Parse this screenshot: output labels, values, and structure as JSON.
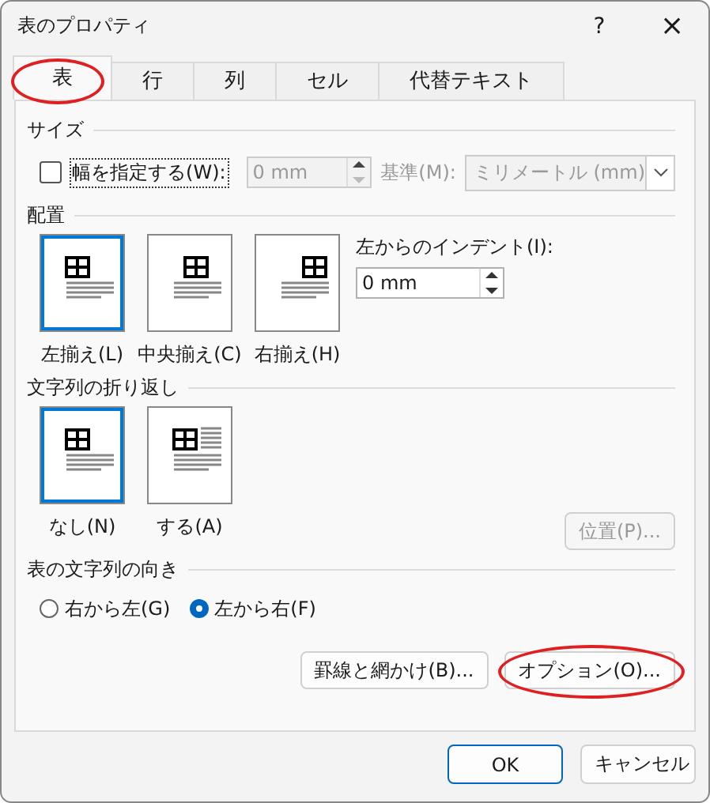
{
  "window": {
    "title": "表のプロパティ",
    "help": "?",
    "close": "×"
  },
  "tabs": [
    {
      "label": "表",
      "selected": true,
      "circled": true
    },
    {
      "label": "行",
      "selected": false,
      "circled": false
    },
    {
      "label": "列",
      "selected": false,
      "circled": false
    },
    {
      "label": "セル",
      "selected": false,
      "circled": false
    },
    {
      "label": "代替テキスト",
      "selected": false,
      "circled": false
    }
  ],
  "size": {
    "heading": "サイズ",
    "width_checkbox": {
      "label": "幅を指定する(W):",
      "checked": false
    },
    "width_field": {
      "value": "0 mm",
      "disabled": true
    },
    "basis_label": {
      "text": "基準(M):",
      "disabled": true
    },
    "basis_dropdown": {
      "value": "ミリメートル (mm)",
      "disabled": true
    }
  },
  "alignment": {
    "heading": "配置",
    "options": [
      {
        "kind": "left",
        "label": "左揃え(L)",
        "selected": true
      },
      {
        "kind": "center",
        "label": "中央揃え(C)",
        "selected": false
      },
      {
        "kind": "right",
        "label": "右揃え(H)",
        "selected": false
      }
    ],
    "indent_label": "左からのインデント(I):",
    "indent_field": {
      "value": "0 mm",
      "disabled": false
    }
  },
  "text_wrapping": {
    "heading": "文字列の折り返し",
    "options": [
      {
        "kind": "none",
        "label": "なし(N)",
        "selected": true
      },
      {
        "kind": "around",
        "label": "する(A)",
        "selected": false
      }
    ],
    "position_button": {
      "label": "位置(P)...",
      "disabled": true
    }
  },
  "direction": {
    "heading": "表の文字列の向き",
    "options": [
      {
        "label": "右から左(G)",
        "selected": false
      },
      {
        "label": "左から右(F)",
        "selected": true
      }
    ]
  },
  "panel_buttons": [
    {
      "label": "罫線と網かけ(B)...",
      "circled": false
    },
    {
      "label": "オプション(O)...",
      "circled": true
    }
  ],
  "footer_buttons": [
    {
      "label": "OK",
      "default": true
    },
    {
      "label": "キャンセル",
      "default": false
    }
  ]
}
